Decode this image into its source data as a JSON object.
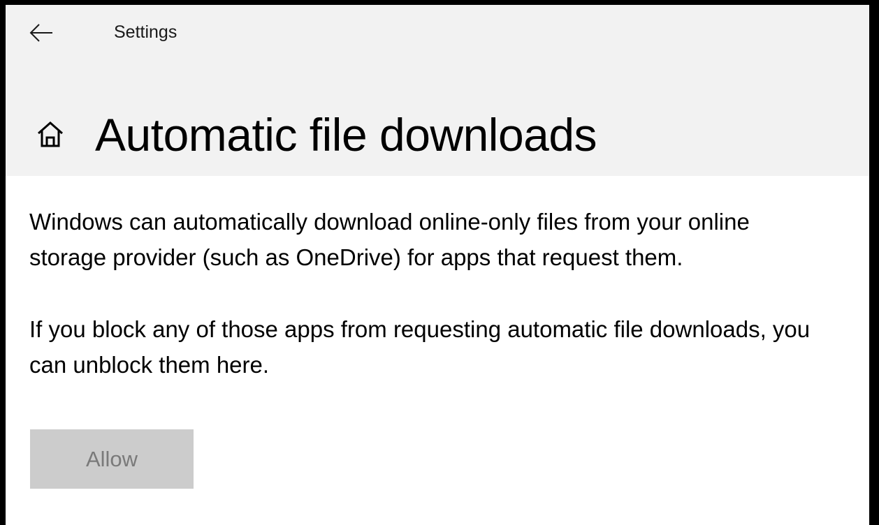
{
  "window": {
    "app_title": "Settings"
  },
  "header": {
    "back_icon": "arrow-left-icon",
    "home_icon": "home-icon",
    "page_title": "Automatic file downloads"
  },
  "content": {
    "paragraph_1": "Windows can automatically download online-only files from your online storage provider (such as OneDrive) for apps that request them.",
    "paragraph_2": "If you block any of those apps from requesting automatic file downloads, you can unblock them here.",
    "allow_button_label": "Allow",
    "allow_button_state": "disabled"
  },
  "colors": {
    "header_background": "#f2f2f2",
    "content_background": "#ffffff",
    "button_disabled_background": "#cccccc",
    "button_disabled_text": "#7a7a7a"
  }
}
